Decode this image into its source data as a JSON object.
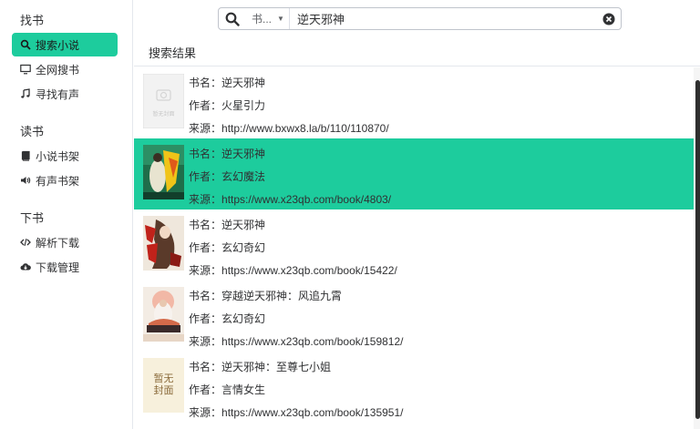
{
  "sidebar": {
    "sections": [
      {
        "title": "找书"
      },
      {
        "title": "读书"
      },
      {
        "title": "下书"
      }
    ],
    "items": [
      {
        "label": "搜索小说",
        "icon": "search-icon"
      },
      {
        "label": "全网搜书",
        "icon": "monitor-icon"
      },
      {
        "label": "寻找有声",
        "icon": "music-note-icon"
      },
      {
        "label": "小说书架",
        "icon": "book-icon"
      },
      {
        "label": "有声书架",
        "icon": "speaker-icon"
      },
      {
        "label": "解析下载",
        "icon": "code-icon"
      },
      {
        "label": "下载管理",
        "icon": "cloud-download-icon"
      }
    ]
  },
  "search": {
    "type_label": "书...",
    "query": "逆天邪神"
  },
  "results": {
    "title": "搜索结果",
    "items": [
      {
        "name_key": "书名：",
        "name": "逆天邪神",
        "author_key": "作者：",
        "author": "火星引力",
        "source_key": "来源：",
        "source": "http://www.bxwx8.la/b/110/110870/",
        "cover_text": "暂无封面"
      },
      {
        "name_key": "书名：",
        "name": "逆天邪神",
        "author_key": "作者：",
        "author": "玄幻魔法",
        "source_key": "来源：",
        "source": "https://www.x23qb.com/book/4803/",
        "cover_text": ""
      },
      {
        "name_key": "书名：",
        "name": "逆天邪神",
        "author_key": "作者：",
        "author": "玄幻奇幻",
        "source_key": "来源：",
        "source": "https://www.x23qb.com/book/15422/",
        "cover_text": ""
      },
      {
        "name_key": "书名：",
        "name": "穿越逆天邪神：风追九霄",
        "author_key": "作者：",
        "author": "玄幻奇幻",
        "source_key": "来源：",
        "source": "https://www.x23qb.com/book/159812/",
        "cover_text": ""
      },
      {
        "name_key": "书名：",
        "name": "逆天邪神：至尊七小姐",
        "author_key": "作者：",
        "author": "言情女生",
        "source_key": "来源：",
        "source": "https://www.x23qb.com/book/135951/",
        "cover_text": "暂无封面"
      }
    ]
  },
  "colors": {
    "accent": "#1dcc9d"
  }
}
